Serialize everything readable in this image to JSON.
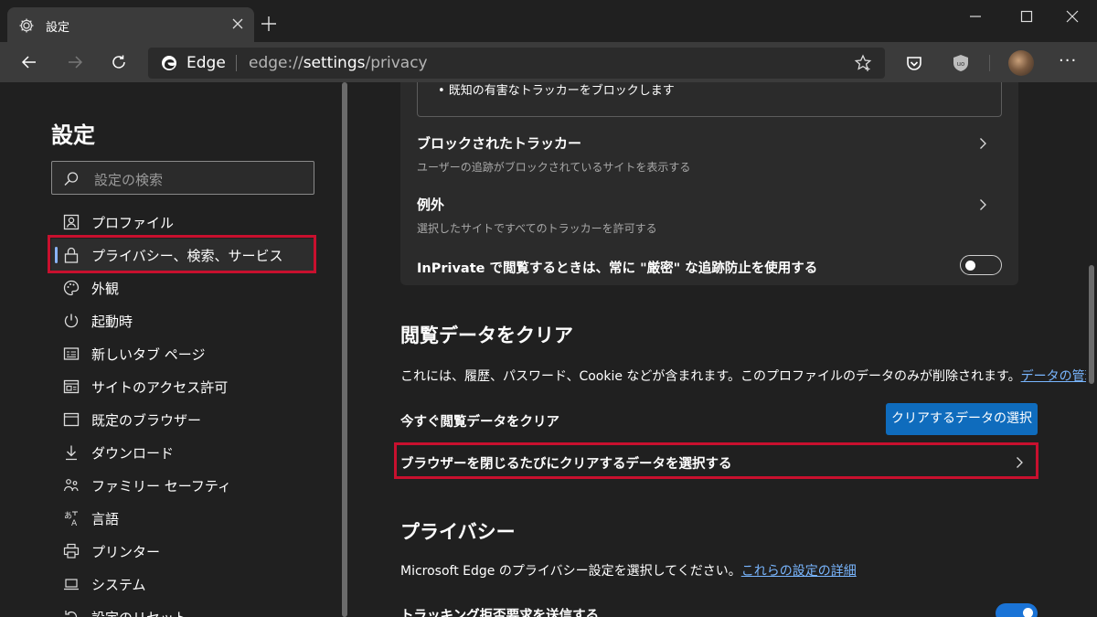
{
  "tab": {
    "title": "設定"
  },
  "address": {
    "site_name": "Edge",
    "url_prefix": "edge://",
    "url_main": "settings",
    "url_suffix": "/privacy"
  },
  "sidebar": {
    "title": "設定",
    "search_placeholder": "設定の検索",
    "items": [
      {
        "label": "プロファイル",
        "icon": "profile-icon"
      },
      {
        "label": "プライバシー、検索、サービス",
        "icon": "lock-icon",
        "active": true
      },
      {
        "label": "外観",
        "icon": "palette-icon"
      },
      {
        "label": "起動時",
        "icon": "power-icon"
      },
      {
        "label": "新しいタブ ページ",
        "icon": "newtab-icon"
      },
      {
        "label": "サイトのアクセス許可",
        "icon": "site-permissions-icon"
      },
      {
        "label": "既定のブラウザー",
        "icon": "browser-icon"
      },
      {
        "label": "ダウンロード",
        "icon": "download-icon"
      },
      {
        "label": "ファミリー セーフティ",
        "icon": "family-icon"
      },
      {
        "label": "言語",
        "icon": "language-icon"
      },
      {
        "label": "プリンター",
        "icon": "printer-icon"
      },
      {
        "label": "システム",
        "icon": "laptop-icon"
      },
      {
        "label": "設定のリセット",
        "icon": "reset-icon"
      }
    ]
  },
  "tracking": {
    "cut_text": "• 既知の有害なトラッカーをブロックします",
    "blocked_title": "ブロックされたトラッカー",
    "blocked_sub": "ユーザーの追跡がブロックされているサイトを表示する",
    "exceptions_title": "例外",
    "exceptions_sub": "選択したサイトですべてのトラッカーを許可する",
    "inprivate_title": "InPrivate で閲覧するときは、常に \"厳密\" な追跡防止を使用する",
    "inprivate_on": false
  },
  "clear_data": {
    "heading": "閲覧データをクリア",
    "desc": "これには、履歴、パスワード、Cookie などが含まれます。このプロファイルのデータのみが削除されます。",
    "manage_link": "データの管理",
    "now_label": "今すぐ閲覧データをクリア",
    "choose_button": "クリアするデータの選択",
    "on_close_label": "ブラウザーを閉じるたびにクリアするデータを選択する"
  },
  "privacy": {
    "heading": "プライバシー",
    "desc": "Microsoft Edge のプライバシー設定を選択してください。",
    "details_link": "これらの設定の詳細",
    "dnt_label": "トラッキング拒否要求を送信する",
    "dnt_on": true
  },
  "colors": {
    "highlight": "#c8102e",
    "accent": "#0f6cbd",
    "link": "#79b6ff"
  }
}
